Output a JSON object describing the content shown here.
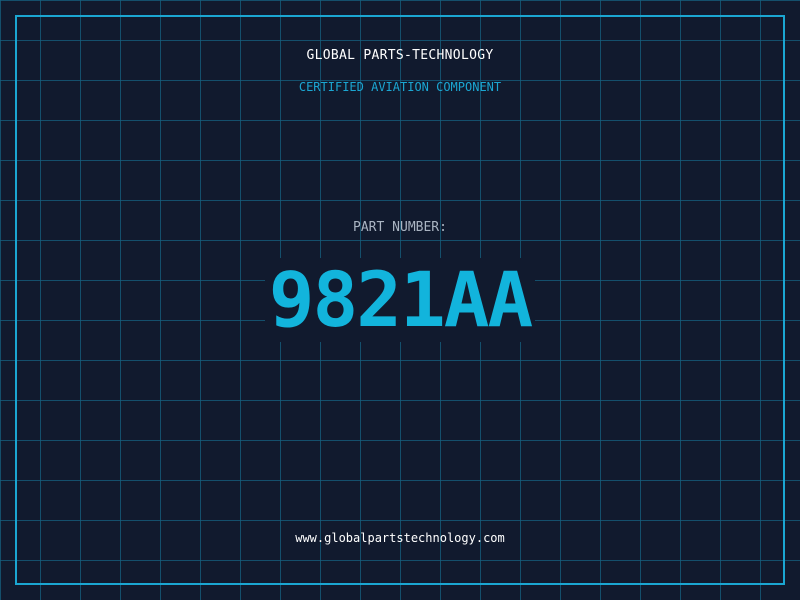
{
  "header": {
    "company": "GLOBAL PARTS-TECHNOLOGY",
    "tagline": "CERTIFIED AVIATION COMPONENT"
  },
  "part": {
    "label": "PART NUMBER:",
    "number": "9821AA"
  },
  "footer": {
    "website": "www.globalpartstechnology.com"
  },
  "colors": {
    "background": "#111a2e",
    "grid": "#166080",
    "accent": "#1ba6d2",
    "part_number": "#12b4dc",
    "text": "#ffffff",
    "label": "#aab4c2"
  }
}
